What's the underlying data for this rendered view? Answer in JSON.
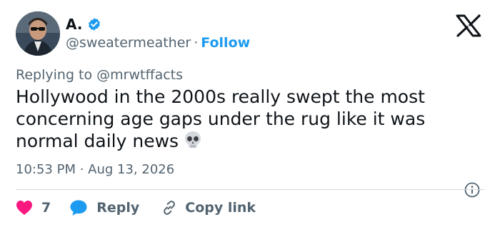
{
  "author": {
    "name": "A.",
    "handle": "@sweatermeather",
    "separator": "·",
    "follow_label": "Follow"
  },
  "reply_context": {
    "prefix": "Replying to",
    "mention": "@mrwtffacts"
  },
  "tweet": {
    "text": "Hollywood in the 2000s really swept the most concerning age gaps under the rug like it was normal daily news",
    "emoji_icon": "skull-emoji"
  },
  "meta": {
    "timestamp": "10:53 PM · Aug 13, 2026"
  },
  "actions": {
    "like_count": "7",
    "reply_label": "Reply",
    "copy_link_label": "Copy link"
  },
  "colors": {
    "accent": "#1d9bf0",
    "like": "#f91880",
    "secondary_text": "#536471",
    "primary_text": "#0f1419",
    "divider": "#cfd9de"
  }
}
